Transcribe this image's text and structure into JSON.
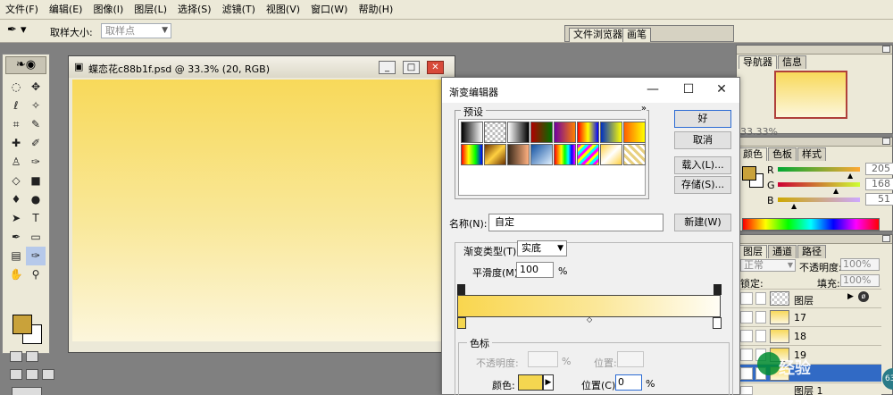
{
  "menubar": {
    "items": [
      "文件(F)",
      "编辑(E)",
      "图像(I)",
      "图层(L)",
      "选择(S)",
      "滤镜(T)",
      "视图(V)",
      "窗口(W)",
      "帮助(H)"
    ]
  },
  "options_bar": {
    "sample_size_label": "取样大小:",
    "sample_size_value": "取样点",
    "palette_well_tabs": [
      "文件浏览器",
      "画笔"
    ]
  },
  "document": {
    "title": "蝶恋花c88b1f.psd @ 33.3% (20, RGB)",
    "gradient_colors": [
      "#f8d95a",
      "#fcf6dc"
    ]
  },
  "gradient_editor": {
    "title": "渐变编辑器",
    "presets_label": "预设",
    "more_glyph": "»",
    "buttons": {
      "ok": "好",
      "cancel": "取消",
      "load": "载入(L)...",
      "save": "存储(S)...",
      "new": "新建(W)"
    },
    "name_label": "名称(N):",
    "name_value": "自定",
    "gradient_type_label": "渐变类型(T):",
    "gradient_type_value": "实底",
    "smoothness_label": "平滑度(M):",
    "smoothness_value": "100",
    "percent": "%",
    "stops_label": "色标",
    "opacity_label": "不透明度:",
    "opacity_position_label": "位置:",
    "color_label": "颜色:",
    "color_position_label": "位置(C):",
    "color_position_value": "0",
    "selected_stop_color": "#f4d650",
    "preset_swatches": [
      "linear-gradient(90deg,#000,#fff)",
      "repeating-conic-gradient(#bbb 0% 25%,#fff 0% 50%) 50%/6px 6px",
      "linear-gradient(90deg,#fff,#000)",
      "linear-gradient(90deg,#b00000,#007000)",
      "linear-gradient(90deg,#7000a0,#ff8000)",
      "linear-gradient(90deg,#ff0000,#ffff00,#0000ff)",
      "linear-gradient(90deg,#0030c0,#ffff00)",
      "linear-gradient(90deg,#ff6000,#ffff00)",
      "linear-gradient(90deg,#ff0000,#ffff00,#00ff00,#0000ff)",
      "linear-gradient(135deg,#6a3000,#ffd040,#6a3000)",
      "linear-gradient(90deg,#3a2a1a,#ffb080)",
      "linear-gradient(135deg,#1050a0,#e0f0ff)",
      "linear-gradient(90deg,#ff0000,#ff8000,#ffff00,#00ff00,#00ffff,#0000ff,#ff00ff)",
      "repeating-linear-gradient(135deg,#ff00ff 0 3px,#ffff00 3px 6px,#00ffff 6px 9px)",
      "linear-gradient(135deg,#ffd040,#ffffff,#ffd040)",
      "repeating-linear-gradient(45deg,#e8d080 0 3px,#ffffff 3px 6px)"
    ]
  },
  "navigator": {
    "tabs": [
      "导航器",
      "信息"
    ],
    "zoom": "33.33%"
  },
  "color_palette": {
    "tabs": [
      "颜色",
      "色板",
      "样式"
    ],
    "foreground_color": "#c9a23a",
    "channels": [
      {
        "label": "R",
        "value": "205"
      },
      {
        "label": "G",
        "value": "168"
      },
      {
        "label": "B",
        "value": "51"
      }
    ]
  },
  "layers": {
    "tabs": [
      "图层",
      "通道",
      "路径"
    ],
    "blend_mode": "正常",
    "opacity_label": "不透明度:",
    "opacity_value": "100%",
    "lock_label": "锁定:",
    "fill_label": "填充:",
    "fill_value": "100%",
    "rows": [
      "图层",
      "17",
      "18",
      "19",
      "",
      "图层 1"
    ]
  },
  "watermark": "经验",
  "avatar_text": "63"
}
